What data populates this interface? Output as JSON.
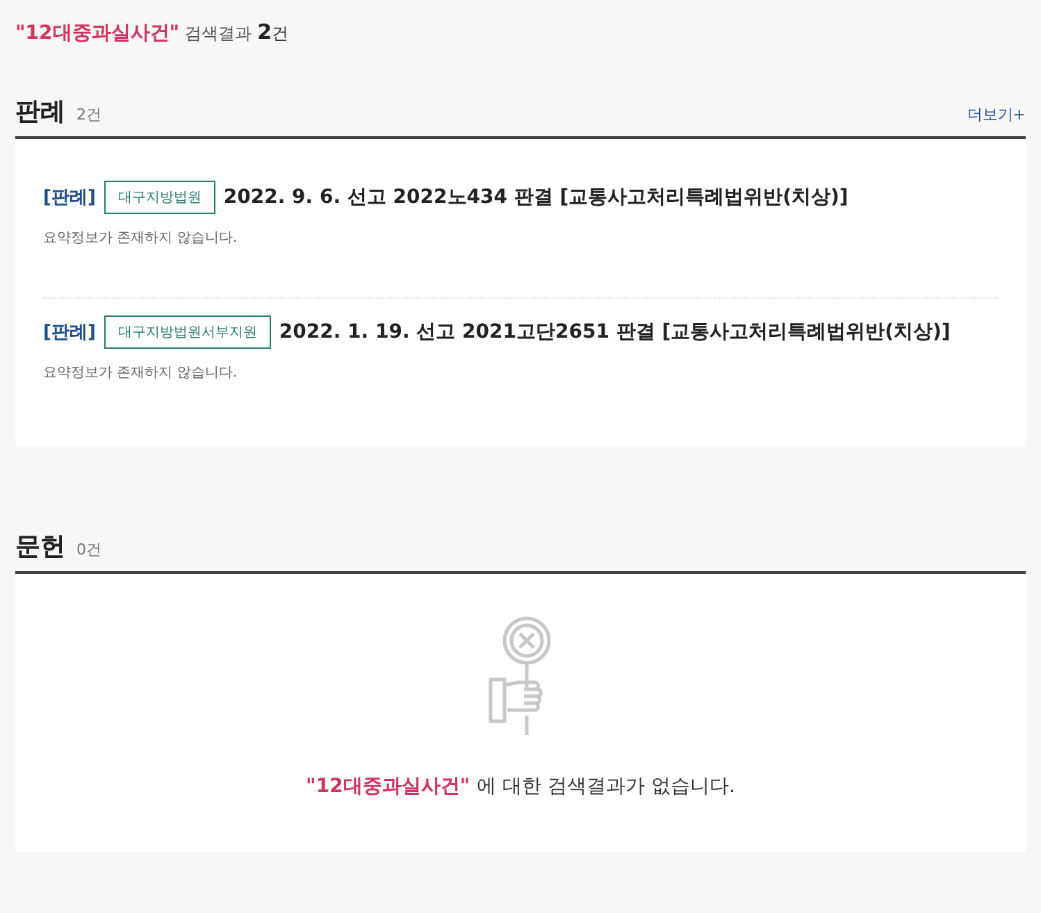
{
  "summary": {
    "query": "\"12대중과실사건\"",
    "label": "검색결과",
    "count": "2",
    "unit": "건"
  },
  "sections": [
    {
      "title": "판례",
      "count": "2건",
      "more": "더보기+",
      "items": [
        {
          "type": "[판례]",
          "court": "대구지방법원",
          "title": "2022. 9. 6. 선고 2022노434 판결 [교통사고처리특례법위반(치상)]",
          "summary": "요약정보가 존재하지 않습니다."
        },
        {
          "type": "[판례]",
          "court": "대구지방법원서부지원",
          "title": "2022. 1. 19. 선고 2021고단2651 판결 [교통사고처리특례법위반(치상)]",
          "summary": "요약정보가 존재하지 않습니다."
        }
      ]
    },
    {
      "title": "문헌",
      "count": "0건",
      "empty": {
        "query": "\"12대중과실사건\"",
        "message": "에 대한 검색결과가 없습니다."
      }
    }
  ]
}
